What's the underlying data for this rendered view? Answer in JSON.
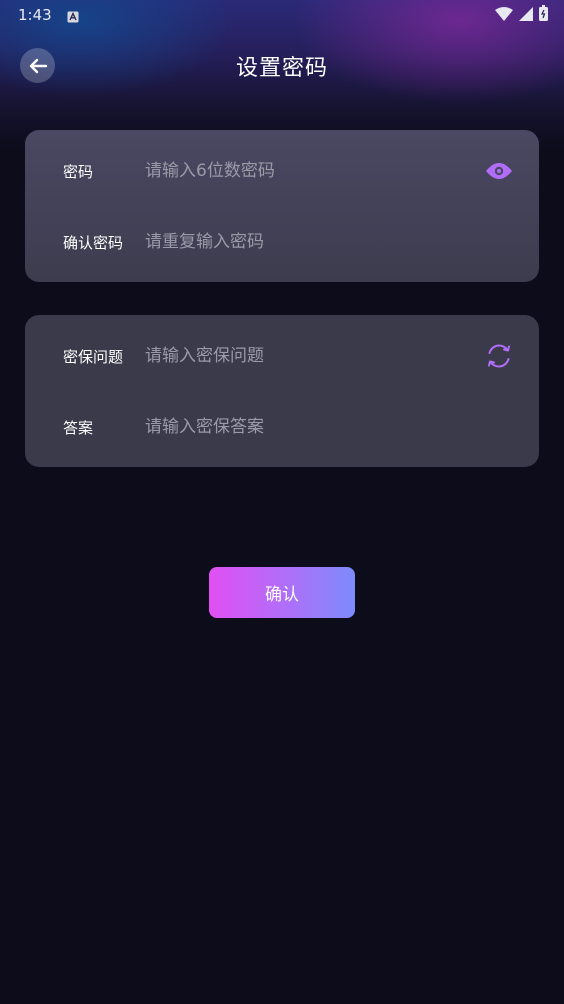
{
  "status_bar": {
    "time": "1:43",
    "icons": [
      "app-notification-icon",
      "wifi-icon",
      "signal-icon",
      "battery-icon"
    ]
  },
  "header": {
    "title": "设置密码",
    "back_icon": "arrow-left-icon"
  },
  "password_card": {
    "password": {
      "label": "密码",
      "placeholder": "请输入6位数密码",
      "value": "",
      "icon": "eye-icon"
    },
    "confirm_password": {
      "label": "确认密码",
      "placeholder": "请重复输入密码",
      "value": ""
    }
  },
  "security_card": {
    "question": {
      "label": "密保问题",
      "placeholder": "请输入密保问题",
      "value": "",
      "icon": "refresh-icon"
    },
    "answer": {
      "label": "答案",
      "placeholder": "请输入密保答案",
      "value": ""
    }
  },
  "confirm_button": {
    "label": "确认"
  },
  "colors": {
    "background": "#0c0c1b",
    "accent": "#b26df8",
    "accent_pink": "#e14ff3",
    "accent_blue": "#7d8bfb",
    "placeholder": "#9b9aa8"
  }
}
